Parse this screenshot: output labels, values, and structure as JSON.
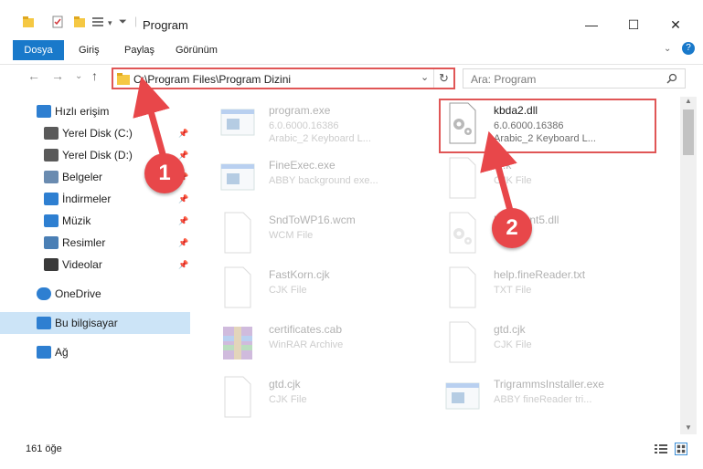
{
  "window": {
    "title": "Program",
    "minimize_glyph": "—",
    "maximize_glyph": "☐",
    "close_glyph": "✕"
  },
  "ribbon": {
    "tabs": [
      "Dosya",
      "Giriş",
      "Paylaş",
      "Görünüm"
    ],
    "active_tab": "Dosya",
    "help_glyph": "?"
  },
  "address": {
    "path": "C:\\Program Files\\Program Dizini",
    "search_placeholder": "Ara: Program"
  },
  "sidebar": {
    "items": [
      {
        "label": "Hızlı erişim",
        "icon": "star-icon",
        "pinned": false
      },
      {
        "label": "Yerel Disk (C:)",
        "icon": "drive-icon",
        "pinned": true
      },
      {
        "label": "Yerel Disk (D:)",
        "icon": "drive-icon",
        "pinned": true
      },
      {
        "label": "Belgeler",
        "icon": "documents-icon",
        "pinned": true
      },
      {
        "label": "İndirmeler",
        "icon": "download-icon",
        "pinned": true
      },
      {
        "label": "Müzik",
        "icon": "music-icon",
        "pinned": true
      },
      {
        "label": "Resimler",
        "icon": "pictures-icon",
        "pinned": true
      },
      {
        "label": "Videolar",
        "icon": "videos-icon",
        "pinned": true
      },
      {
        "label": "OneDrive",
        "icon": "cloud-icon",
        "pinned": false
      },
      {
        "label": "Bu bilgisayar",
        "icon": "computer-icon",
        "pinned": false,
        "selected": true
      },
      {
        "label": "Ağ",
        "icon": "network-icon",
        "pinned": false
      }
    ]
  },
  "files": [
    {
      "name": "program.exe",
      "line1": "6.0.6000.16386",
      "line2": "Arabic_2 Keyboard L...",
      "icon": "exe-icon"
    },
    {
      "name": "kbda2.dll",
      "line1": "6.0.6000.16386",
      "line2": "Arabic_2 Keyboard L...",
      "icon": "dll-icon",
      "highlighted": true
    },
    {
      "name": "FineExec.exe",
      "line1": "ABBY background exe...",
      "line2": "",
      "icon": "exe-icon"
    },
    {
      "name": "....k",
      "line1": "CJK File",
      "line2": "",
      "icon": "file-icon"
    },
    {
      "name": "SndToWP16.wcm",
      "line1": "WCM File",
      "line2": "",
      "icon": "file-icon"
    },
    {
      "name": "U...Client5.dll",
      "line1": "...n DLL",
      "line2": "",
      "icon": "dll-icon"
    },
    {
      "name": "FastKorn.cjk",
      "line1": "CJK File",
      "line2": "",
      "icon": "file-icon"
    },
    {
      "name": "help.fineReader.txt",
      "line1": "TXT File",
      "line2": "",
      "icon": "file-icon"
    },
    {
      "name": "certificates.cab",
      "line1": "WinRAR Archive",
      "line2": "",
      "icon": "archive-icon"
    },
    {
      "name": "gtd.cjk",
      "line1": "CJK File",
      "line2": "",
      "icon": "file-icon"
    },
    {
      "name": "gtd.cjk",
      "line1": "CJK File",
      "line2": "",
      "icon": "file-icon"
    },
    {
      "name": "TrigrammsInstaller.exe",
      "line1": "ABBY fineReader tri...",
      "line2": "",
      "icon": "exe-icon"
    }
  ],
  "status": {
    "count_text": "161 öğe"
  },
  "annotations": {
    "badge1": "1",
    "badge2": "2"
  },
  "colors": {
    "accent": "#1979ca",
    "highlight": "#e05656",
    "badge": "#e8474a",
    "selected_bg": "#cce4f7"
  }
}
